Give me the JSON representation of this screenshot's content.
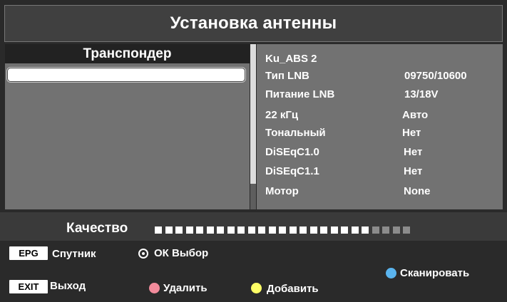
{
  "title": "Установка антенны",
  "left_panel": {
    "header": "Транспондер",
    "selected_value": ""
  },
  "satellite": "Ku_ABS 2",
  "properties": [
    {
      "label": "Тип LNB",
      "value": "09750/10600"
    },
    {
      "label": "Питание LNB",
      "value": "13/18V"
    },
    {
      "label": "22 кГц",
      "value": "Авто"
    },
    {
      "label": "Тональный",
      "value": "Нет"
    },
    {
      "label": "DiSEqC1.0",
      "value": "Нет"
    },
    {
      "label": "DiSEqC1.1",
      "value": "Нет"
    },
    {
      "label": "Мотор",
      "value": "None"
    }
  ],
  "quality": {
    "label": "Качество",
    "level": 0.84,
    "segments_total": 25,
    "segments_on": 21
  },
  "footer": {
    "epg_key": "EPG",
    "epg_label": "Спутник",
    "ok_label": "ОК Выбор",
    "exit_key": "EXIT",
    "exit_label": "Выход",
    "red_label": "Удалить",
    "yellow_label": "Добавить",
    "blue_label": "Сканировать",
    "colors": {
      "red": "#f28b9b",
      "yellow": "#ffff66",
      "blue": "#5ab4ee"
    }
  }
}
